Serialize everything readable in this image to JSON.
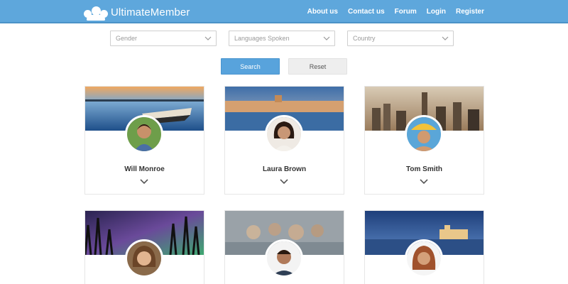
{
  "header": {
    "brand": "UltimateMember",
    "nav": [
      "About us",
      "Contact us",
      "Forum",
      "Login",
      "Register"
    ]
  },
  "filters": {
    "gender_placeholder": "Gender",
    "languages_placeholder": "Languages Spoken",
    "country_placeholder": "Country"
  },
  "actions": {
    "search_label": "Search",
    "reset_label": "Reset"
  },
  "members": [
    {
      "name": "Will Monroe"
    },
    {
      "name": "Laura Brown"
    },
    {
      "name": "Tom Smith"
    },
    {
      "name": ""
    },
    {
      "name": ""
    },
    {
      "name": ""
    }
  ],
  "icons": {
    "logo": "users-group-icon",
    "select_chevron": "chevron-down-icon",
    "card_toggle": "chevron-down-icon"
  },
  "colors": {
    "header_bg": "#5ea7dc",
    "primary_button": "#58a3dc",
    "secondary_button": "#eeeeee"
  }
}
